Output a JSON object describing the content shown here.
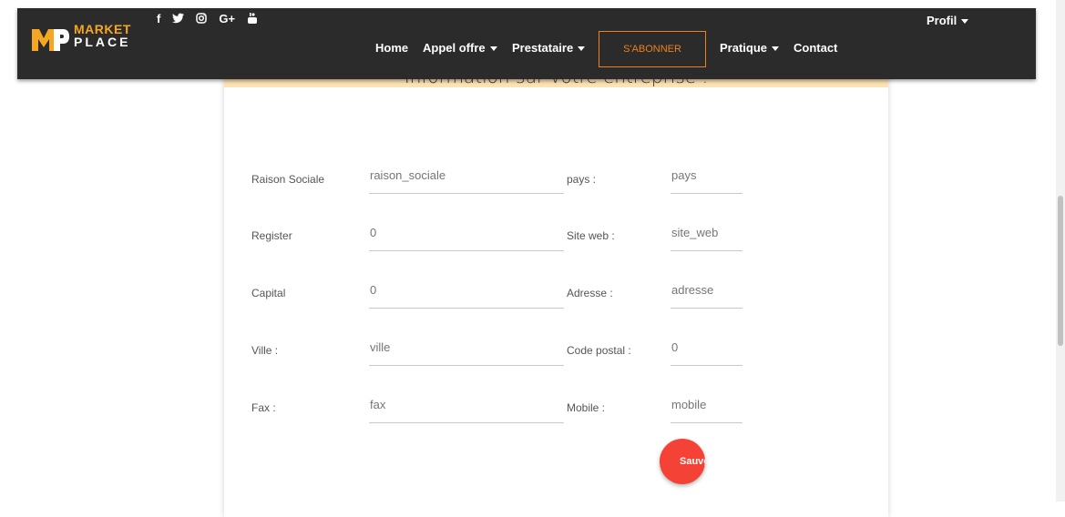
{
  "header": {
    "logo": {
      "line1": "MARKET",
      "line2": "PLACE"
    },
    "socials": [
      {
        "icon": "facebook-icon",
        "glyph": "f"
      },
      {
        "icon": "twitter-icon",
        "glyph": "🐦"
      },
      {
        "icon": "instagram-icon",
        "glyph": "◎"
      },
      {
        "icon": "google-plus-icon",
        "glyph": "G+"
      },
      {
        "icon": "youtube-icon",
        "glyph": "▶"
      }
    ],
    "nav": {
      "home": "Home",
      "appel_offre": "Appel offre",
      "prestataire": "Prestataire",
      "subscribe": "S'ABONNER",
      "pratique": "Pratique",
      "contact": "Contact"
    },
    "profil": "Profil"
  },
  "banner_title": "Information sur votre entreprise :",
  "form": {
    "left": [
      {
        "label": "Raison Sociale",
        "value": "raison_sociale"
      },
      {
        "label": "Register",
        "value": "0"
      },
      {
        "label": "Capital",
        "value": "0"
      },
      {
        "label": "Ville :",
        "value": "ville"
      },
      {
        "label": "Fax :",
        "value": "fax"
      }
    ],
    "right": [
      {
        "label": "pays :",
        "value": "pays"
      },
      {
        "label": "Site web :",
        "value": "site_web"
      },
      {
        "label": "Adresse :",
        "value": "adresse"
      },
      {
        "label": "Code postal :",
        "value": "0"
      },
      {
        "label": "Mobile :",
        "value": "mobile"
      }
    ],
    "save_label": "Sauvgarder"
  },
  "colors": {
    "header_bg": "#2b2b2b",
    "accent": "#f5a623",
    "subscribe": "#f0801e",
    "save": "#f44336",
    "banner": "#fde2b4"
  }
}
